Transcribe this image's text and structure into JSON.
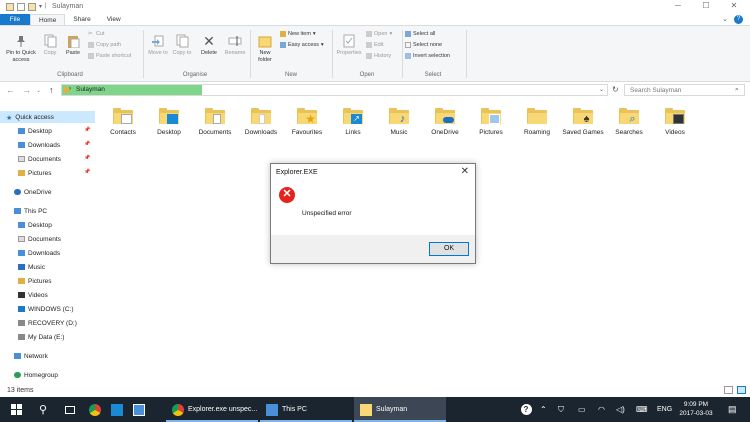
{
  "window": {
    "title": "Sulayman"
  },
  "ribbon": {
    "tabs": [
      "File",
      "Home",
      "Share",
      "View"
    ],
    "clipboard": {
      "group_label": "Clipboard",
      "pin_label": "Pin to Quick access",
      "copy_label": "Copy",
      "paste_label": "Paste",
      "cut_label": "Cut",
      "copy_path_label": "Copy path",
      "paste_shortcut_label": "Paste shortcut"
    },
    "organise": {
      "group_label": "Organise",
      "move_to_label": "Move to",
      "copy_to_label": "Copy to",
      "delete_label": "Delete",
      "rename_label": "Rename"
    },
    "new": {
      "group_label": "New",
      "new_folder_label": "New folder",
      "new_item_label": "New item",
      "easy_access_label": "Easy access"
    },
    "open": {
      "group_label": "Open",
      "properties_label": "Properties",
      "open_label": "Open",
      "edit_label": "Edit",
      "history_label": "History"
    },
    "select": {
      "group_label": "Select",
      "select_all_label": "Select all",
      "select_none_label": "Select none",
      "invert_selection_label": "Invert selection"
    }
  },
  "address": {
    "path": "Sulayman",
    "search_placeholder": "Search Sulayman"
  },
  "nav": {
    "quick_access": "Quick access",
    "quick_items": [
      "Desktop",
      "Downloads",
      "Documents",
      "Pictures"
    ],
    "onedrive": "OneDrive",
    "this_pc": "This PC",
    "pc_items": [
      "Desktop",
      "Documents",
      "Downloads",
      "Music",
      "Pictures",
      "Videos",
      "WINDOWS (C:)",
      "RECOVERY (D:)",
      "My Data (E:)"
    ],
    "network": "Network",
    "homegroup": "Homegroup"
  },
  "files": [
    "Contacts",
    "Desktop",
    "Documents",
    "Downloads",
    "Favourites",
    "Links",
    "Music",
    "OneDrive",
    "Pictures",
    "Roaming",
    "Saved Games",
    "Searches",
    "Videos"
  ],
  "status": {
    "item_count": "13 items"
  },
  "dialog": {
    "title": "Explorer.EXE",
    "message": "Unspecified error",
    "ok_label": "OK"
  },
  "taskbar": {
    "items": [
      "Explorer.exe unspec...",
      "This PC",
      "Sulayman"
    ],
    "language": "ENG",
    "time": "9:09 PM",
    "date": "2017-03-03"
  },
  "colors": {
    "accent": "#1979ca",
    "address_highlight": "#7ed68a",
    "error_red": "#e5231c",
    "taskbar": "#1b2530",
    "folder": "#f8d775"
  }
}
